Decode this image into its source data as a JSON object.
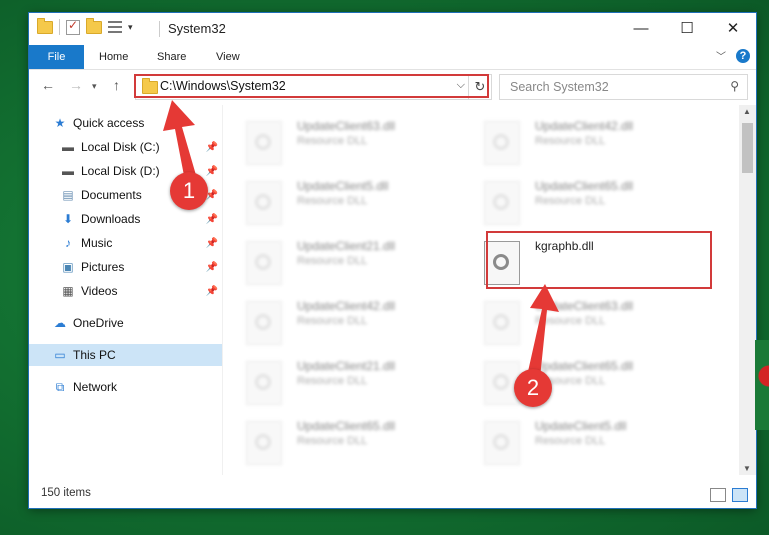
{
  "window": {
    "title": "System32",
    "controls": {
      "minimize": "—",
      "maximize": "☐",
      "close": "✕"
    }
  },
  "ribbon": {
    "tabs": [
      {
        "label": "File",
        "active": true
      },
      {
        "label": "Home"
      },
      {
        "label": "Share"
      },
      {
        "label": "View"
      }
    ],
    "help": "?"
  },
  "navigation": {
    "address": "C:\\Windows\\System32",
    "search_placeholder": "Search System32"
  },
  "sidebar": {
    "items": [
      {
        "label": "Quick access",
        "icon": "star-icon"
      },
      {
        "label": "Local Disk (C:)",
        "icon": "drive-icon",
        "pinned": true
      },
      {
        "label": "Local Disk (D:)",
        "icon": "drive-icon",
        "pinned": true
      },
      {
        "label": "Documents",
        "icon": "documents-icon",
        "pinned": true
      },
      {
        "label": "Downloads",
        "icon": "download-icon",
        "pinned": true
      },
      {
        "label": "Music",
        "icon": "music-icon",
        "pinned": true
      },
      {
        "label": "Pictures",
        "icon": "pictures-icon",
        "pinned": true
      },
      {
        "label": "Videos",
        "icon": "videos-icon",
        "pinned": true
      },
      {
        "label": "OneDrive",
        "icon": "cloud-icon"
      },
      {
        "label": "This PC",
        "icon": "computer-icon",
        "selected": true
      },
      {
        "label": "Network",
        "icon": "network-icon"
      }
    ]
  },
  "files": [
    {
      "name": "UpdateClient63.dll",
      "type": "Resource DLL"
    },
    {
      "name": "UpdateClient42.dll",
      "type": "Resource DLL"
    },
    {
      "name": "UpdateClient5.dll",
      "type": "Resource DLL"
    },
    {
      "name": "UpdateClient65.dll",
      "type": "Resource DLL"
    },
    {
      "name": "UpdateClient21.dll",
      "type": "Resource DLL"
    },
    {
      "name": "kgraphb.dll",
      "type": "",
      "highlighted": true
    },
    {
      "name": "UpdateClient42.dll",
      "type": "Resource DLL"
    },
    {
      "name": "UpdateClient63.dll",
      "type": "Resource DLL"
    },
    {
      "name": "UpdateClient21.dll",
      "type": "Resource DLL"
    },
    {
      "name": "UpdateClient65.dll",
      "type": "Resource DLL"
    },
    {
      "name": "UpdateClient65.dll",
      "type": "Resource DLL"
    },
    {
      "name": "UpdateClient5.dll",
      "type": "Resource DLL"
    }
  ],
  "status": {
    "item_count": "150 items"
  },
  "annotations": [
    {
      "number": "1",
      "target": "address-bar"
    },
    {
      "number": "2",
      "target": "kgraphb.dll"
    }
  ],
  "colors": {
    "accent": "#1979ca",
    "annotation": "#e53935",
    "selected": "#cce4f7"
  }
}
